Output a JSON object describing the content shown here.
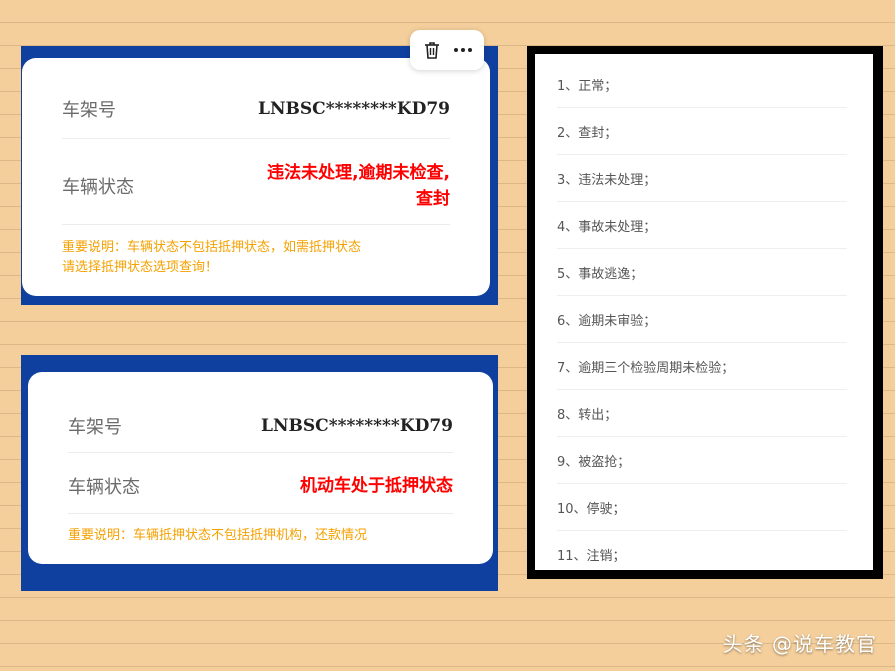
{
  "card_top": {
    "vin_label": "车架号",
    "vin_value": "LNBSC********KD79",
    "status_label": "车辆状态",
    "status_value_line1": "违法未处理,逾期未检查,",
    "status_value_line2": "查封",
    "note_line1": "重要说明：车辆状态不包括抵押状态，如需抵押状态",
    "note_line2": "请选择抵押状态选项查询！"
  },
  "card_bottom": {
    "vin_label": "车架号",
    "vin_value": "LNBSC********KD79",
    "status_label": "车辆状态",
    "status_value": "机动车处于抵押状态",
    "note": "重要说明：车辆抵押状态不包括抵押机构，还款情况"
  },
  "toolbar": {
    "delete_icon": "trash-icon",
    "more_icon": "more-icon"
  },
  "status_list": {
    "items": [
      "1、正常；",
      "2、查封；",
      "3、违法未处理；",
      "4、事故未处理；",
      "5、事故逃逸；",
      "6、逾期未审验；",
      "7、逾期三个检验周期未检验；",
      "8、转出；",
      "9、被盗抢；",
      "10、停驶；",
      "11、注销；"
    ]
  },
  "watermark": "头条 @说车教官",
  "colors": {
    "frame_blue": "#0f3f9f",
    "status_red": "#ff0000",
    "note_orange": "#f5a100",
    "background": "#f4cf9c"
  }
}
